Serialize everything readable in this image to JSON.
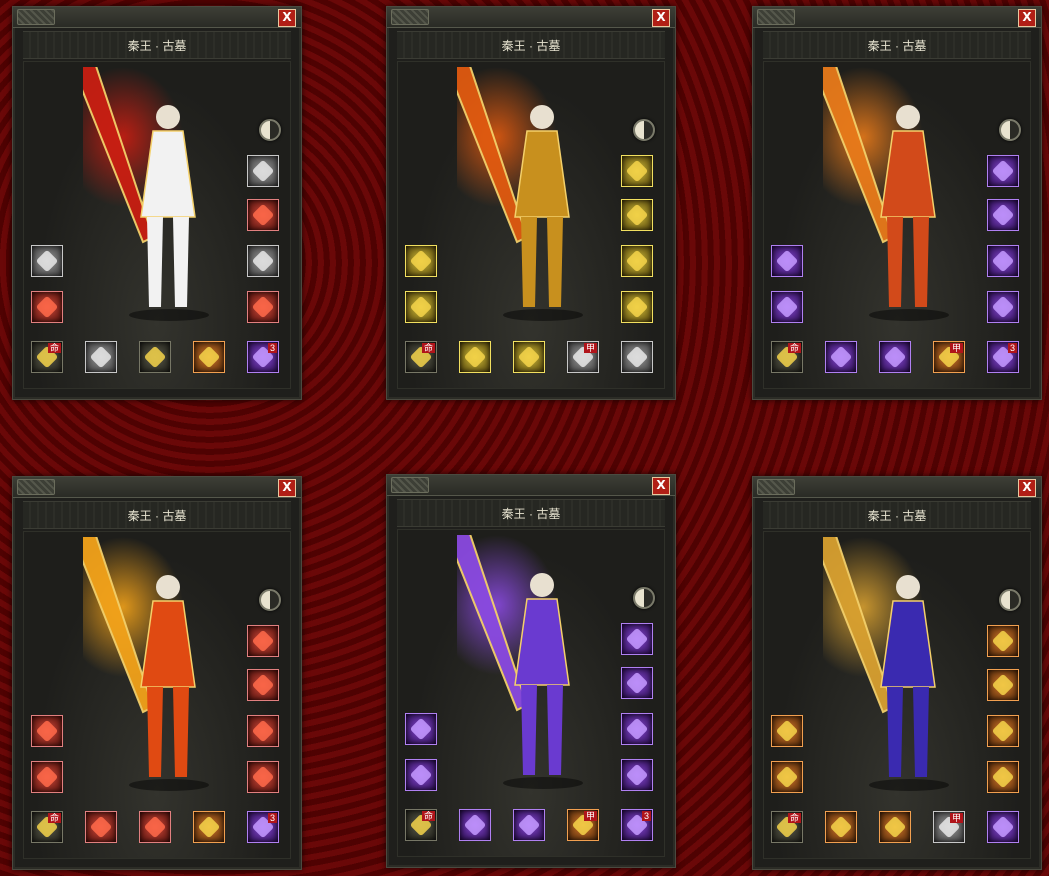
{
  "panels": [
    {
      "title": "秦王 · 古墓",
      "close": "X",
      "weapon_color": "#c81e12",
      "body_color": "#f2f2f2",
      "right": [
        "gray",
        "red",
        "gray",
        "red"
      ],
      "left": [
        "gray",
        "red"
      ],
      "bottom": [
        "dark",
        "gray",
        "dark",
        "orange",
        "purple"
      ],
      "badges": [
        "命",
        "",
        "",
        "",
        "3"
      ]
    },
    {
      "title": "秦王 · 古墓",
      "close": "X",
      "weapon_color": "#e05a10",
      "body_color": "#c8901e",
      "right": [
        "gold",
        "gold",
        "gold",
        "gold"
      ],
      "left": [
        "gold",
        "gold"
      ],
      "bottom": [
        "dark",
        "gold",
        "gold",
        "gray",
        "gray"
      ],
      "badges": [
        "命",
        "",
        "",
        "甲",
        ""
      ]
    },
    {
      "title": "秦王 · 古墓",
      "close": "X",
      "weapon_color": "#e87a1a",
      "body_color": "#d24a1a",
      "right": [
        "purple",
        "purple",
        "purple",
        "purple"
      ],
      "left": [
        "purple",
        "purple"
      ],
      "bottom": [
        "dark",
        "purple",
        "purple",
        "orange",
        "purple"
      ],
      "badges": [
        "命",
        "",
        "",
        "甲",
        "3"
      ]
    },
    {
      "title": "秦王 · 古墓",
      "close": "X",
      "weapon_color": "#f2a21a",
      "body_color": "#e04a12",
      "right": [
        "red",
        "red",
        "red",
        "red"
      ],
      "left": [
        "red",
        "red"
      ],
      "bottom": [
        "dark",
        "red",
        "red",
        "orange",
        "purple"
      ],
      "badges": [
        "命",
        "",
        "",
        "",
        "3"
      ]
    },
    {
      "title": "秦王 · 古墓",
      "close": "X",
      "weapon_color": "#8a4ae0",
      "body_color": "#6a3ad0",
      "right": [
        "purple",
        "purple",
        "purple",
        "purple"
      ],
      "left": [
        "purple",
        "purple"
      ],
      "bottom": [
        "dark",
        "purple",
        "purple",
        "orange",
        "purple"
      ],
      "badges": [
        "命",
        "",
        "",
        "甲",
        "3"
      ]
    },
    {
      "title": "秦王 · 古墓",
      "close": "X",
      "weapon_color": "#d8a030",
      "body_color": "#3a2ab0",
      "right": [
        "orange",
        "orange",
        "orange",
        "orange"
      ],
      "left": [
        "orange",
        "orange"
      ],
      "bottom": [
        "dark",
        "orange",
        "orange",
        "gray",
        "purple"
      ],
      "badges": [
        "命",
        "",
        "",
        "甲",
        ""
      ]
    }
  ]
}
